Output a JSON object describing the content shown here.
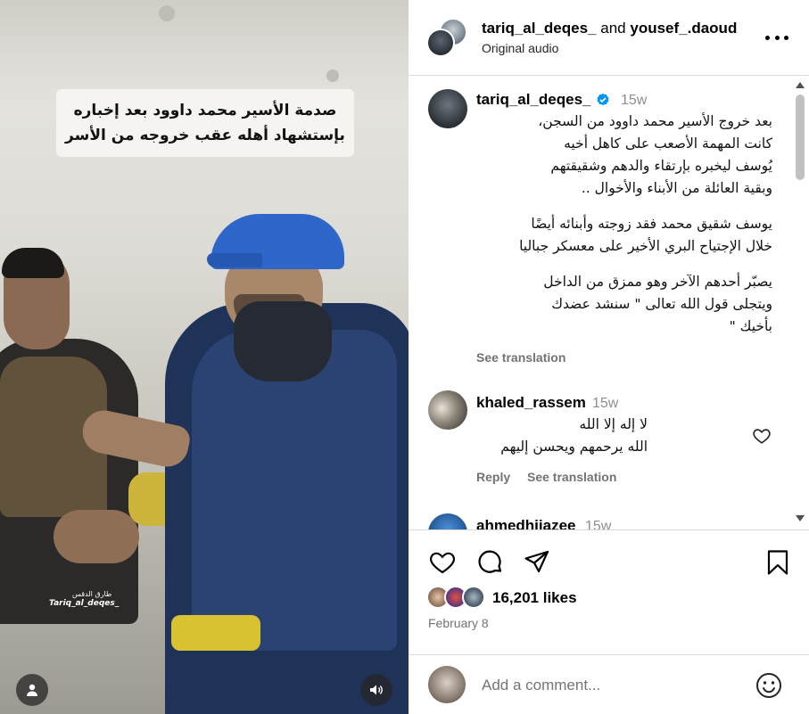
{
  "video": {
    "caption_lines": [
      "صدمة الأسير محمد داوود بعد إخباره",
      "بإستشهاد أهله عقب خروجه من الأسر"
    ],
    "watermark_ar": "طارق الدقس",
    "watermark_en": "Tariq_al_deqes_",
    "profile_icon": "person-icon",
    "sound_icon": "speaker-icon"
  },
  "header": {
    "user1": "tariq_al_deqes_",
    "connector": "and",
    "user2": "yousef_.daoud",
    "subtitle": "Original audio",
    "more_icon": "more-horizontal-icon"
  },
  "caption": {
    "username": "tariq_al_deqes_",
    "time": "15w",
    "lines": [
      "بعد خروج الأسير محمد داوود من السجن،",
      "كانت المهمة الأصعب على كاهل أخيه",
      "يُوسف ليخبره بإرتقاء والدهم وشقيقتهم",
      "وبقية العائلة من الأبناء والأخوال ..",
      "",
      "يوسف شقيق محمد فقد زوجته وأبنائه أيضًا",
      "خلال الإجتياح البري الأخير على معسكر جباليا",
      "",
      "يصبّر أحدهم الآخر وهو ممزق من الداخل",
      "ويتجلى قول الله تعالى \" سنشد عضدك",
      "بأخيك \""
    ],
    "see_translation": "See translation"
  },
  "comments": [
    {
      "username": "khaled_rassem",
      "time": "15w",
      "lines": [
        "لا إله إلا الله",
        "الله يرحمهم ويحسن إليهم"
      ],
      "reply": "Reply",
      "see_translation": "See translation"
    },
    {
      "username": "ahmedhijazee",
      "time": "15w"
    }
  ],
  "actions": {
    "like_icon": "heart-icon",
    "comment_icon": "comment-icon",
    "share_icon": "send-icon",
    "save_icon": "bookmark-icon",
    "likes": "16,201 likes",
    "date": "February 8"
  },
  "comment_box": {
    "placeholder": "Add a comment...",
    "emoji_icon": "emoji-icon"
  },
  "colors": {
    "verified": "#0095f6",
    "secondary_text": "#737373",
    "divider": "#dbdbdb",
    "cap_blue": "#2f66c9"
  }
}
